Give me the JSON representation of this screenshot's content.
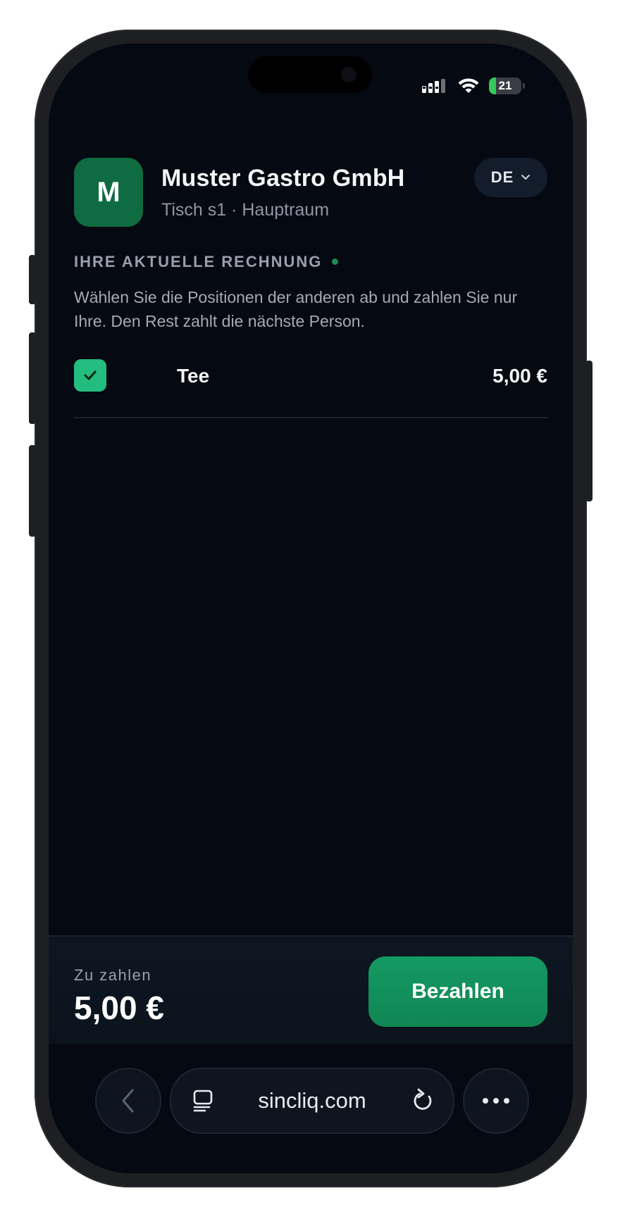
{
  "status_bar": {
    "battery": "21",
    "battery_level": 0.21
  },
  "header": {
    "logo_letter": "M",
    "restaurant_name": "Muster Gastro GmbH",
    "table_info": "Tisch s1 · Hauptraum",
    "language": "DE"
  },
  "bill": {
    "section_title": "IHRE AKTUELLE RECHNUNG",
    "instruction": "Wählen Sie die Positionen der anderen ab und zahlen Sie nur Ihre. Den Rest zahlt die nächste Person.",
    "items": [
      {
        "name": "Tee",
        "price": "5,00 €",
        "selected": true
      }
    ]
  },
  "footer": {
    "due_label": "Zu zahlen",
    "due_amount": "5,00 €",
    "pay_button": "Bezahlen"
  },
  "browser": {
    "url": "sincliq.com"
  },
  "colors": {
    "background": "#050911",
    "accent": "#149a63",
    "checkbox": "#22bd7f",
    "logo": "#0f6b42"
  }
}
